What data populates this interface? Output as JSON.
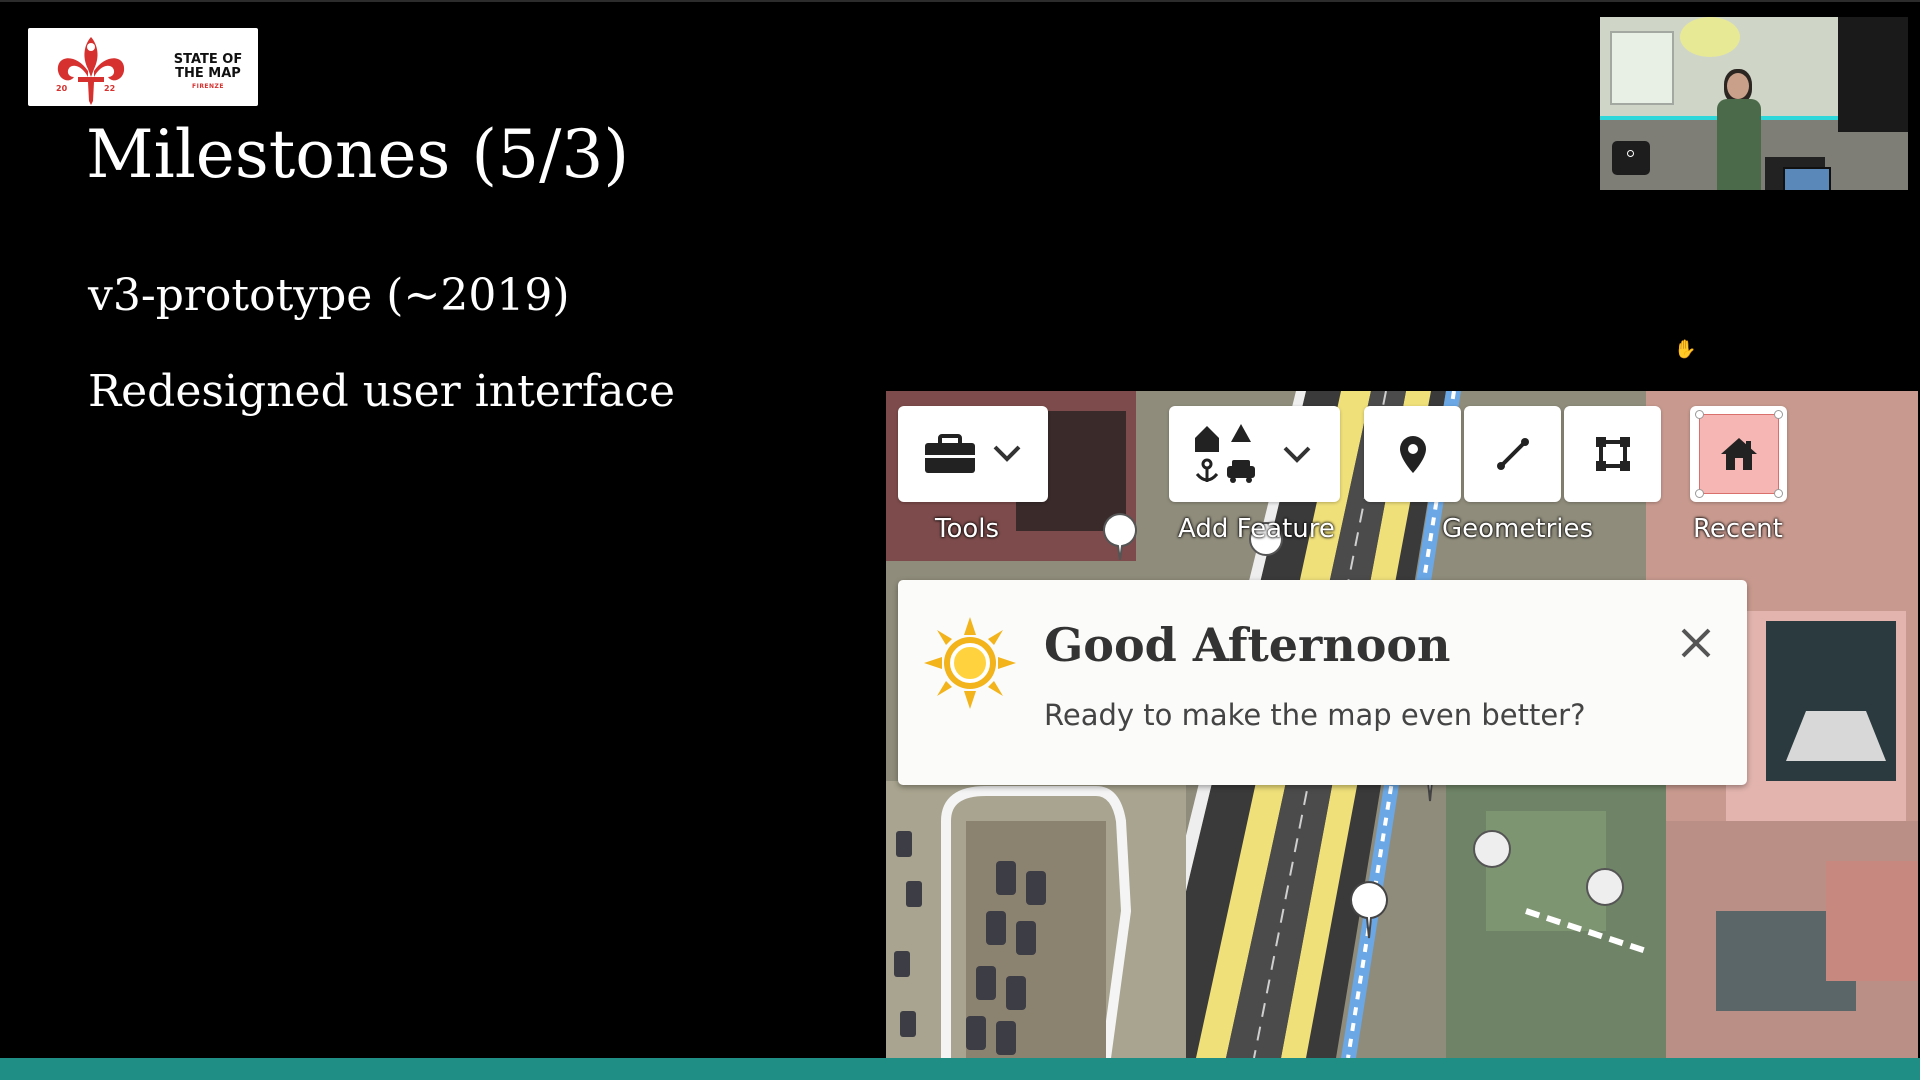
{
  "logo": {
    "line1": "STATE OF",
    "line2": "THE MAP",
    "city": "FIRENZE",
    "year_left": "20",
    "year_right": "22"
  },
  "slide": {
    "title": "Milestones (5/3)",
    "subtitle": "v3-prototype (~2019)",
    "description": "Redesigned user interface"
  },
  "app": {
    "toolbar": {
      "tools_label": "Tools",
      "add_feature_label": "Add Feature",
      "geometries_label": "Geometries",
      "recent_label": "Recent"
    },
    "welcome": {
      "title": "Good Afternoon",
      "message": "Ready to make the map even better?"
    }
  },
  "colors": {
    "bottom_bar": "#1f8f86",
    "logo_red": "#d6312f",
    "sun": "#f2b31b",
    "recent_fill": "#f6b6b3"
  }
}
